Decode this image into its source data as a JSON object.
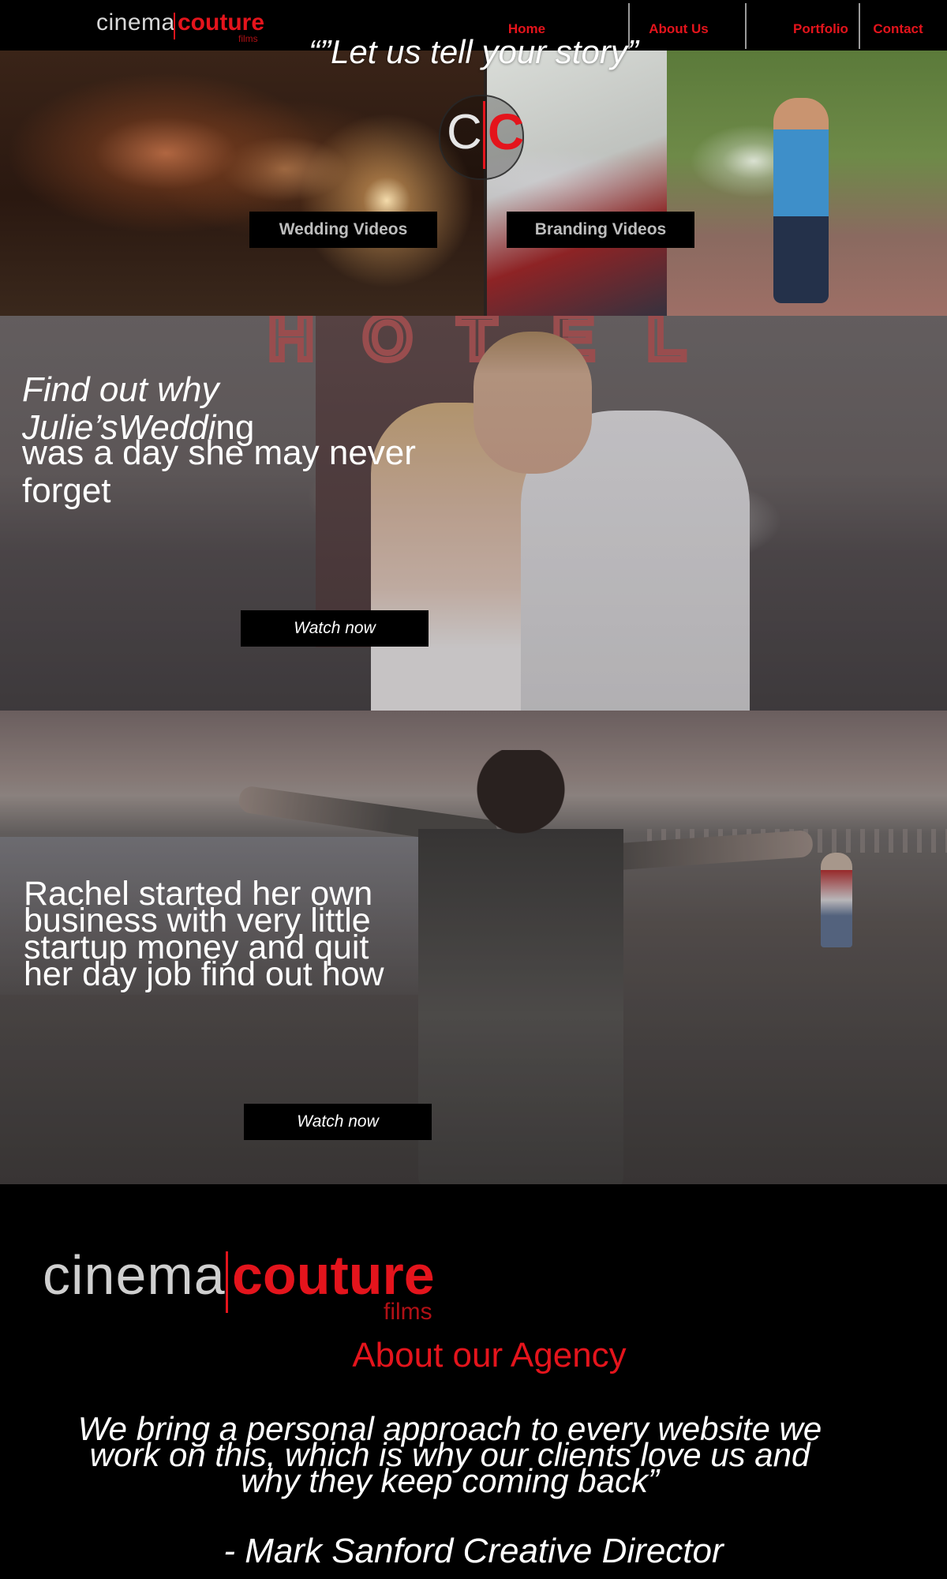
{
  "brand": {
    "word1": "cinema",
    "word2": "couture",
    "word3": "films"
  },
  "nav": {
    "items": [
      "Home",
      "About Us",
      "Portfolio",
      "Contact"
    ]
  },
  "hero": {
    "quote": "“”Let us tell your story”",
    "mark_left": "C",
    "mark_right": "C",
    "buttons": [
      "Wedding Videos",
      "Branding Videos"
    ]
  },
  "wedding": {
    "line1_italic": "Find out why Julie’sWeddi",
    "line1_rest": "ng",
    "line2": "was a day she may never",
    "line3": "forget",
    "sign": [
      "H",
      "O",
      "T",
      "E",
      "L"
    ],
    "button": "Watch now"
  },
  "beach": {
    "lines": [
      "Rachel started her own",
      "business with very little",
      "startup money and quit",
      "her day job find out how"
    ],
    "button": "Watch now"
  },
  "about": {
    "title": "About our Agency",
    "quote_lines": [
      "We bring a personal approach to every website we",
      "work on this, which is why our clients love us and",
      "why they keep coming back”"
    ],
    "signature": "- Mark Sanford Creative Director"
  }
}
